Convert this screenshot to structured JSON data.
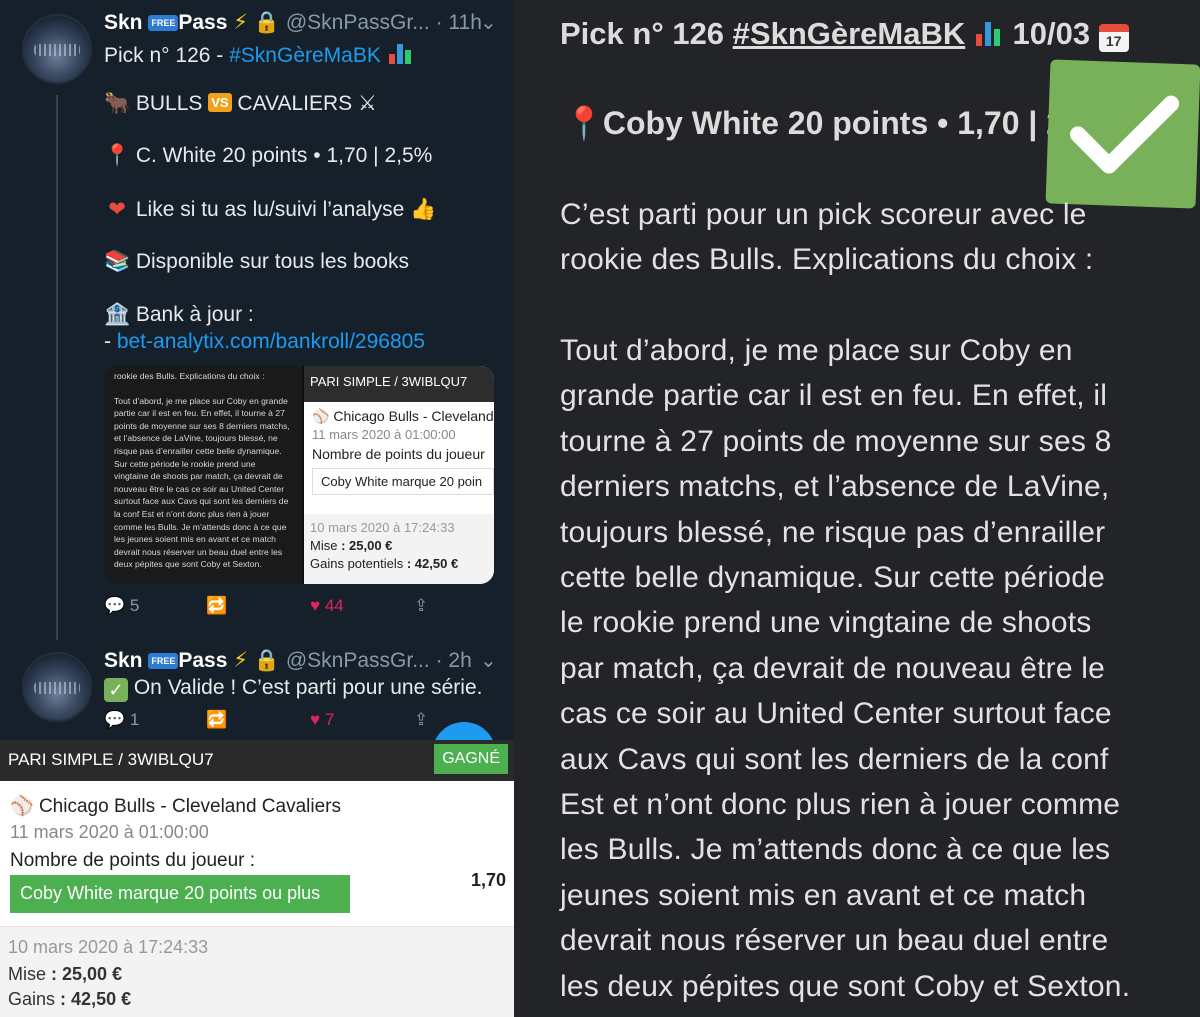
{
  "tweet1": {
    "name": "Skn",
    "badge": "FREE",
    "name2": "Pass",
    "handle": "@SknPassGr...",
    "time": "· 11h",
    "line1_a": "Pick n° 126 - ",
    "line1_tag": "#SknGèreMaBK",
    "matchup_a": "BULLS",
    "matchup_vs": "VS",
    "matchup_b": "CAVALIERS",
    "pick": "C. White 20 points • 1,70 | 2,5%",
    "like": "Like si tu as lu/suivi l’analyse",
    "books": "Disponible sur tous les books",
    "bank": "Bank à jour :",
    "bank_dash": "- ",
    "bank_link": "bet-analytix.com/bankroll/296805",
    "replies": "5",
    "likes": "44"
  },
  "media": {
    "left_p1": "rookie des Bulls. Explications du choix :",
    "left_p2": "Tout d’abord, je me place sur Coby en grande partie car il est en feu. En effet, il tourne à 27 points de moyenne sur ses 8 derniers matchs, et l’absence de LaVine, toujours blessé, ne risque pas d’enrailler cette belle dynamique. Sur cette période le rookie prend une vingtaine de shoots par match, ça devrait de nouveau être le cas ce soir au United Center surtout face aux Cavs qui sont les derniers de la conf Est et n’ont donc plus rien à jouer comme les Bulls. Je m’attends donc à ce que les jeunes soient mis en avant et ce match devrait nous réserver un beau duel entre les deux pépites que sont Coby et Sexton.",
    "head": "PARI SIMPLE / 3WIBLQU7",
    "title": "Chicago Bulls - Cleveland",
    "date": "11 mars 2020 à 01:00:00",
    "kind": "Nombre de points du joueur",
    "selection": "Coby White marque 20 poin",
    "placed": "10 mars 2020 à 17:24:33",
    "stake_label": "Mise",
    "stake": ": 25,00 €",
    "gains_label": "Gains potentiels",
    "gains": ": 42,50 €"
  },
  "tweet2": {
    "name": "Skn",
    "badge": "FREE",
    "name2": "Pass",
    "handle": "@SknPassGr...",
    "time": "· 2h",
    "text": "On Valide ! C’est parti pour une série.",
    "replies": "1",
    "likes": "7"
  },
  "slip": {
    "head": "PARI SIMPLE / 3WIBLQU7",
    "status": "GAGNÉ",
    "title": "Chicago Bulls - Cleveland Cavaliers",
    "date": "11 mars 2020 à 01:00:00",
    "kind": "Nombre de points du joueur :",
    "selection": "Coby White marque 20 points ou plus",
    "odds": "1,70",
    "placed": "10 mars 2020 à 17:24:33",
    "stake_label": "Mise",
    "stake": ": 25,00 €",
    "gains_label": "Gains",
    "gains": ": 42,50 €"
  },
  "notes": {
    "title_a": "Pick n° 126 ",
    "title_tag": "#SknGèreMaBK",
    "title_date": "10/03",
    "cal": "17",
    "sub": "Coby White 20 points • 1,70 | 2",
    "lines1": [
      "C’est parti pour un pick scoreur avec le",
      "rookie des Bulls. Explications du choix :"
    ],
    "lines2": [
      "Tout d’abord, je me place sur Coby en",
      "grande partie car il est en feu. En effet, il",
      "tourne à 27 points de moyenne sur ses 8",
      "derniers matchs, et l’absence de LaVine,",
      "toujours blessé, ne risque pas d’enrailler",
      "cette belle dynamique. Sur cette période",
      "le rookie prend une vingtaine de shoots",
      "par match, ça devrait de nouveau être le",
      "cas ce soir au United Center surtout face",
      "aux Cavs qui sont les derniers de la conf",
      "Est et n’ont donc plus rien à jouer comme",
      "les Bulls. Je m’attends donc à ce que les",
      "jeunes soient mis en avant et ce match",
      "devrait nous réserver un beau duel entre",
      "les deux pépites que sont Coby et Sexton."
    ]
  }
}
